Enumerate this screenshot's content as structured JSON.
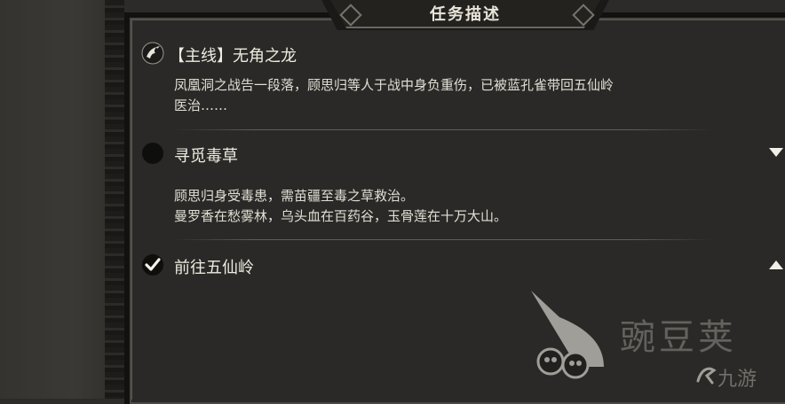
{
  "panel": {
    "title": "任务描述"
  },
  "quests": [
    {
      "icon": "crane-emblem-icon",
      "title": "【主线】无角之龙",
      "desc": [
        "凤凰洞之战告一段落，顾思归等人于战中身负重伤，已被蓝孔雀带回五仙岭",
        "医治……"
      ]
    },
    {
      "icon": "black-circle-icon",
      "title": "寻觅毒草",
      "desc": [
        "顾思归身受毒患，需苗疆至毒之草救治。",
        "曼罗香在愁雾林，乌头血在百药谷，玉骨莲在十万大山。"
      ],
      "toggle": "collapse-triangle-down-icon"
    },
    {
      "icon": "checkmark-circle-icon",
      "title": "前往五仙岭",
      "toggle": "expand-triangle-up-icon"
    }
  ],
  "watermark": {
    "brand": "豌豆荚",
    "site": "九游"
  },
  "colors": {
    "background": "#2c2b29",
    "panel": "#2a2927",
    "text": "#e6e2d8"
  }
}
